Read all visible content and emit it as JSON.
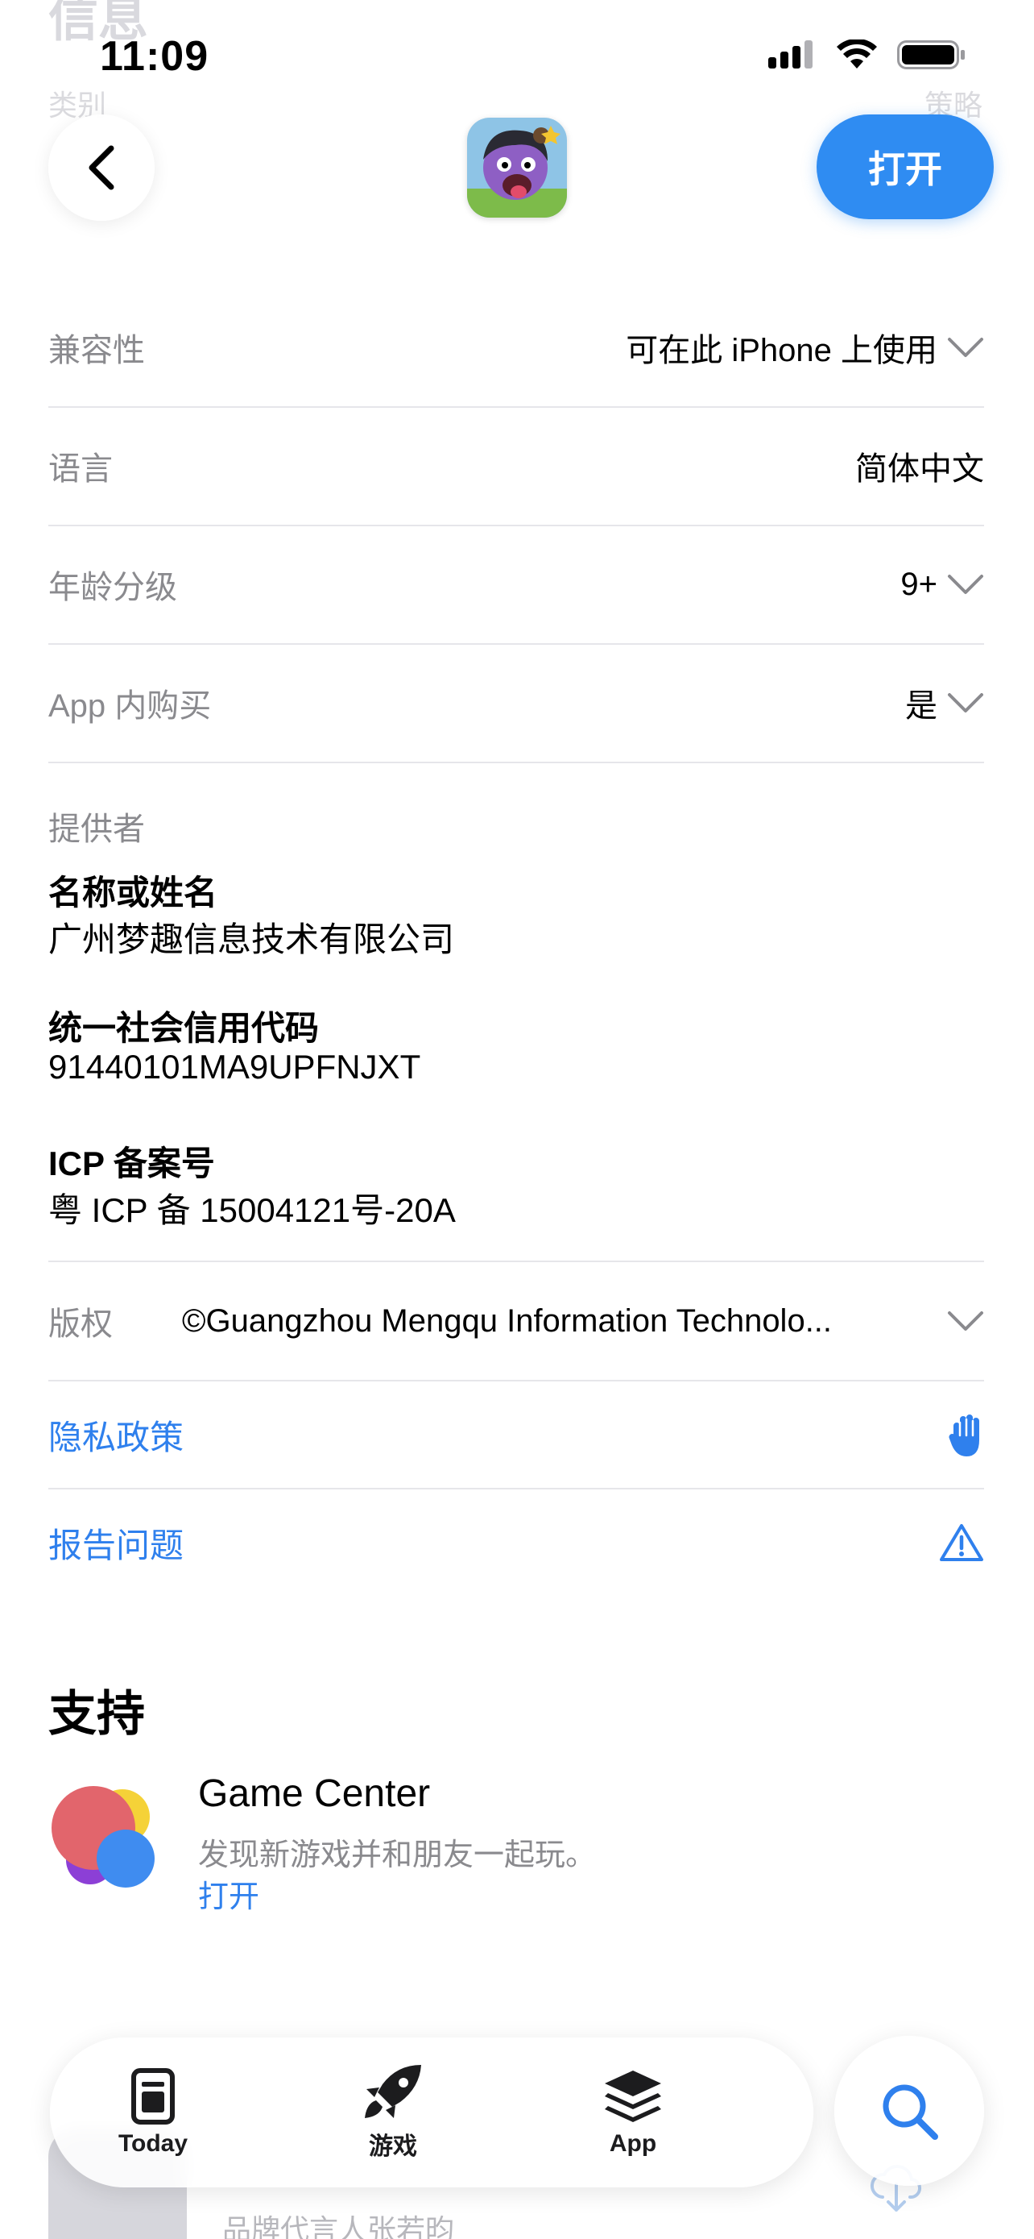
{
  "status_bar": {
    "time": "11:09"
  },
  "nav": {
    "open_label": "打开"
  },
  "ghost": {
    "section_title": "信息",
    "category_label": "类别",
    "category_value": "策略"
  },
  "info": {
    "compatibility": {
      "label": "兼容性",
      "value": "可在此 iPhone 上使用"
    },
    "language": {
      "label": "语言",
      "value": "简体中文"
    },
    "age_rating": {
      "label": "年龄分级",
      "value": "9+"
    },
    "in_app_purchase": {
      "label": "App 内购买",
      "value": "是"
    },
    "provider": {
      "section_label": "提供者",
      "name_label": "名称或姓名",
      "name_value": "广州梦趣信息技术有限公司",
      "credit_code_label": "统一社会信用代码",
      "credit_code_value": "91440101MA9UPFNJXT",
      "icp_label": "ICP 备案号",
      "icp_value": "粤 ICP 备 15004121号-20A"
    },
    "copyright": {
      "label": "版权",
      "value": "©Guangzhou Mengqu Information Technolo..."
    }
  },
  "links": {
    "privacy": "隐私政策",
    "report": "报告问题"
  },
  "support": {
    "heading": "支持",
    "game_center": {
      "title": "Game Center",
      "description": "发现新游戏并和朋友一起玩。",
      "action": "打开"
    }
  },
  "more": {
    "subtitle": "品牌代言人张若昀"
  },
  "tabbar": {
    "today": "Today",
    "games": "游戏",
    "apps": "App"
  },
  "colors": {
    "accent": "#2F8CF2",
    "link": "#2F80ED",
    "label_gray": "#8A8A8E",
    "separator": "#E6E6EA"
  }
}
